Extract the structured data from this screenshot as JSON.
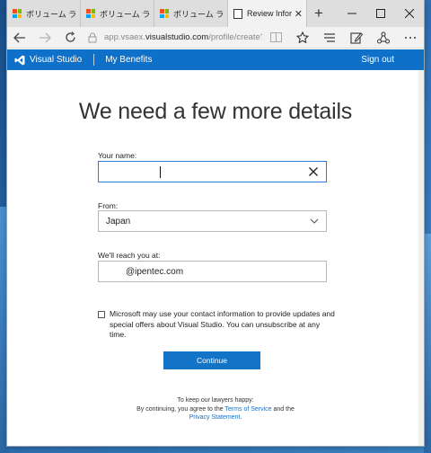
{
  "browser": {
    "tabs": [
      {
        "label": "ボリューム ライセンス",
        "icon": "microsoft-logo-icon"
      },
      {
        "label": "ボリューム ライセンス",
        "icon": "microsoft-logo-icon"
      },
      {
        "label": "ボリューム ライセンス",
        "icon": "microsoft-logo-icon"
      },
      {
        "label": "Review Infor",
        "icon": "page-icon",
        "active": true
      }
    ],
    "new_tab_label": "+",
    "address": {
      "scheme": "app.vsaex.",
      "host": "visualstudio.com",
      "path": "/profile/create?mkt=en"
    }
  },
  "site": {
    "brand": "Visual Studio",
    "nav_link": "My Benefits",
    "signout": "Sign out"
  },
  "form": {
    "heading": "We need a few more details",
    "name_label": "Your name:",
    "name_value": "",
    "from_label": "From:",
    "from_value": "Japan",
    "reach_label": "We'll reach you at:",
    "email_value": "@ipentec.com",
    "consent_text": "Microsoft may use your contact information to provide updates and special offers about Visual Studio. You can unsubscribe at any time.",
    "consent_checked": false,
    "continue_label": "Continue"
  },
  "footer": {
    "line1": "To keep our lawyers happy:",
    "line2_prefix": "By continuing, you agree to the ",
    "terms_link": "Terms of Service",
    "line2_mid": " and the",
    "privacy_link": "Privacy Statement",
    "line3_suffix": "."
  },
  "colors": {
    "brand_blue": "#0e70c8",
    "button_blue": "#1273c7",
    "focus_border": "#2d7ad8",
    "ms_red": "#f25022",
    "ms_green": "#7fba00",
    "ms_blue": "#00a4ef",
    "ms_yellow": "#ffb900"
  }
}
